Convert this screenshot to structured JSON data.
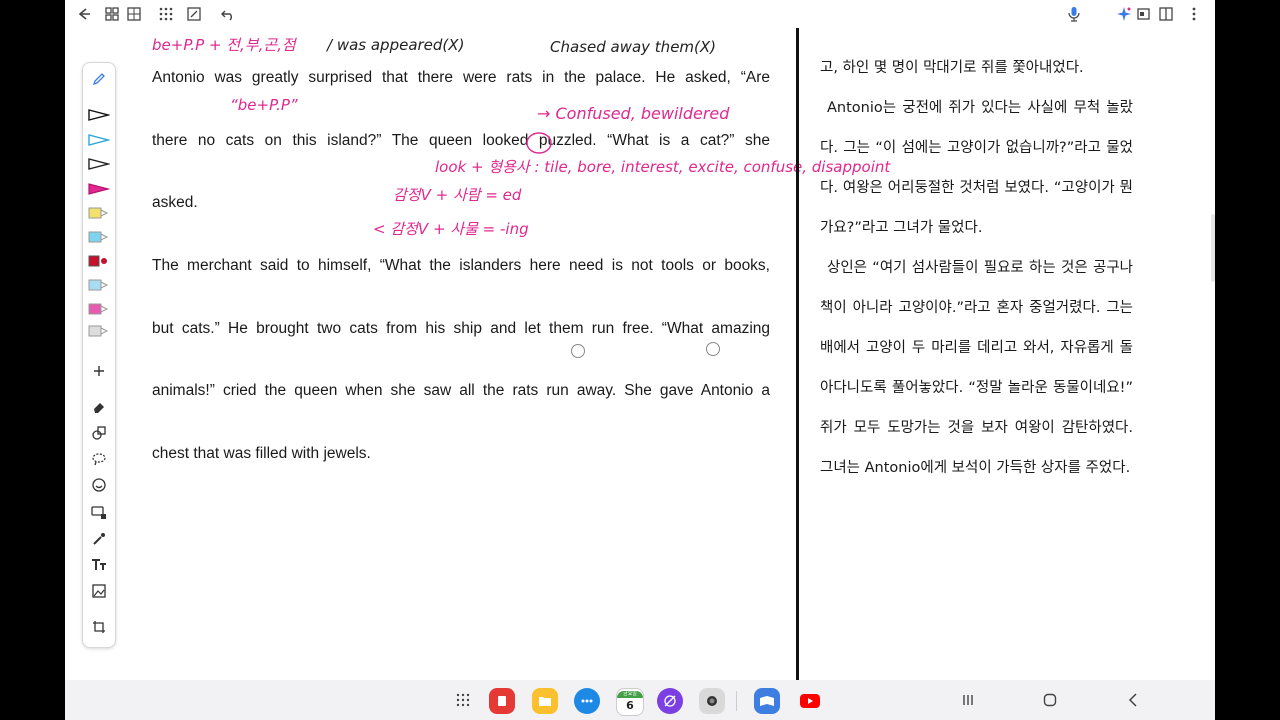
{
  "english_text": {
    "lines": [
      "Antonio was greatly surprised that there were rats in the palace. He asked, “Are",
      "there no cats on this island?” The queen looked puzzled. “What is a cat?” she",
      "asked.",
      "The merchant said to himself, “What the islanders here need is not tools or books,",
      "but cats.” He brought two cats from his ship and let them run free. “What amazing",
      "animals!” cried the queen when she saw all the rats run away. She gave Antonio a",
      "chest that was filled with jewels."
    ]
  },
  "korean_text": {
    "lines": [
      "고, 하인 몇 명이 막대기로 쥐를 쫓아내었다.",
      "Antonio는 궁전에 쥐가 있다는 사실에 무척 놀랐",
      "다. 그는 “이 섬에는 고양이가 없습니까?”라고 물었",
      "다. 여왕은 어리둥절한 것처럼 보였다. “고양이가 뭔",
      "가요?”라고 그녀가 물었다.",
      "상인은 “여기 섬사람들이 필요로 하는 것은 공구나",
      "책이 아니라 고양이야.”라고 혼자 중얼거렸다. 그는",
      "배에서 고양이 두 마리를 데리고 와서, 자유롭게 돌",
      "아다니도록 풀어놓았다. “정말 놀라운 동물이네요!”",
      "쥐가 모두 도망가는 것을 보자 여왕이 감탄하였다.",
      "그녀는 Antonio에게 보석이 가득한 상자를 주었다."
    ]
  },
  "annotations": {
    "top_left": "be+P.P + 전,부,곤,점",
    "top_mid": "/ was appeared(X)",
    "top_right": "Chased away them(X)",
    "be_pp": "“be+P.P”",
    "arrow_note": "→ Confused, bewildered",
    "look_note": "look + 형용사 : tile, bore, interest, excite, confuse, disappoint",
    "emotion_ed": "감정V + 사람 = ed",
    "emotion_ing": "< 감정V + 사물 = -ing"
  },
  "calendar_badge": {
    "day": "6",
    "label": "금요일"
  },
  "icons": {
    "top_toolbar": [
      "back-icon",
      "view-toggle-icon",
      "grid-icon",
      "apps-icon",
      "edit-icon",
      "undo-icon",
      "voice-input-icon",
      "sparkle-icon",
      "window-icon",
      "split-icon",
      "more-icon"
    ],
    "navbar": [
      "app-drawer-icon",
      "recent-apps-icon",
      "home-icon",
      "back-nav-icon"
    ]
  },
  "colors": {
    "ink_pink": "#e0288f",
    "ink_red": "#e23a3a"
  }
}
